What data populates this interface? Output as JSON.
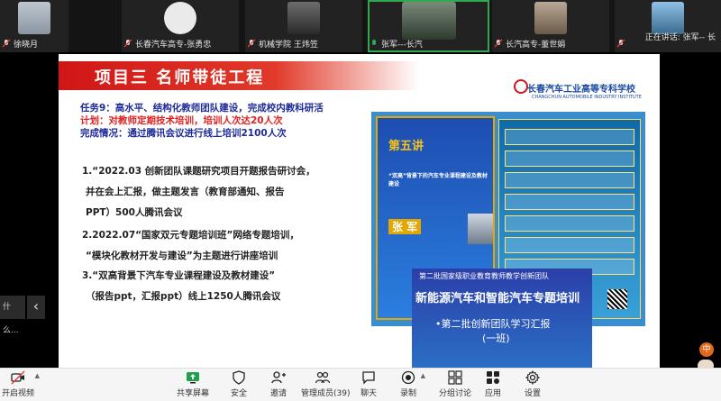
{
  "participants": [
    {
      "name": "徐晓月",
      "muted": true
    },
    {
      "name": "长春汽车高专-张勇忠",
      "muted": true
    },
    {
      "name": "机械学院 王炜笠",
      "muted": true
    },
    {
      "name": "张军---长汽",
      "muted": false,
      "active": true
    },
    {
      "name": "长汽高专-董世娟",
      "muted": true
    },
    {
      "name": "",
      "muted": true
    }
  ],
  "speaking": "正在讲话: 张军-- 长",
  "slide": {
    "title": "项目三  名师带徒工程",
    "college": "长春汽车工业高等专科学校",
    "college_en": "CHANGCHUN AUTOMOBILE INDUSTRY INSTITUTE",
    "task": "任务9：高水平、结构化教师团队建设，完成校内教科研活",
    "plan": "计划：对教师定期技术培训，培训人次达20人次",
    "done": "完成情况：通过腾讯会议进行线上培训2100人次",
    "items": [
      "1.“2022.03 创新团队课题研究项目开题报告研讨会，",
      "并在会上汇报，做主题发言（教育部通知、报告",
      "PPT）500人腾讯会议",
      "2.2022.07“国家双元专题培训班”网络专题培训，",
      "“模块化教材开发与建设”为主题进行讲座培训",
      "3.“双高背景下汽车专业课程建设及教材建设”",
      "（报告ppt，汇报ppt）线上1250人腾讯会议"
    ],
    "poster": {
      "lecture": "第五讲",
      "course": "“双高”背景下的汽车专业课程建设及教材建设",
      "speaker": "张 军"
    },
    "banner": {
      "line1": "第二批国家级职业教育教师教学创新团队",
      "line2": "新能源汽车和智能汽车专题培训",
      "line3": "•第二批创新团队学习汇报",
      "line4": "(一班)"
    }
  },
  "side_left_text": "什么...",
  "toolbar": {
    "video": "开启视频",
    "share": "共享屏幕",
    "security": "安全",
    "invite": "邀请",
    "members": "管理成员(39)",
    "chat": "聊天",
    "record": "录制",
    "breakout": "分组讨论",
    "apps": "应用",
    "settings": "设置"
  },
  "corner_badge": "中"
}
